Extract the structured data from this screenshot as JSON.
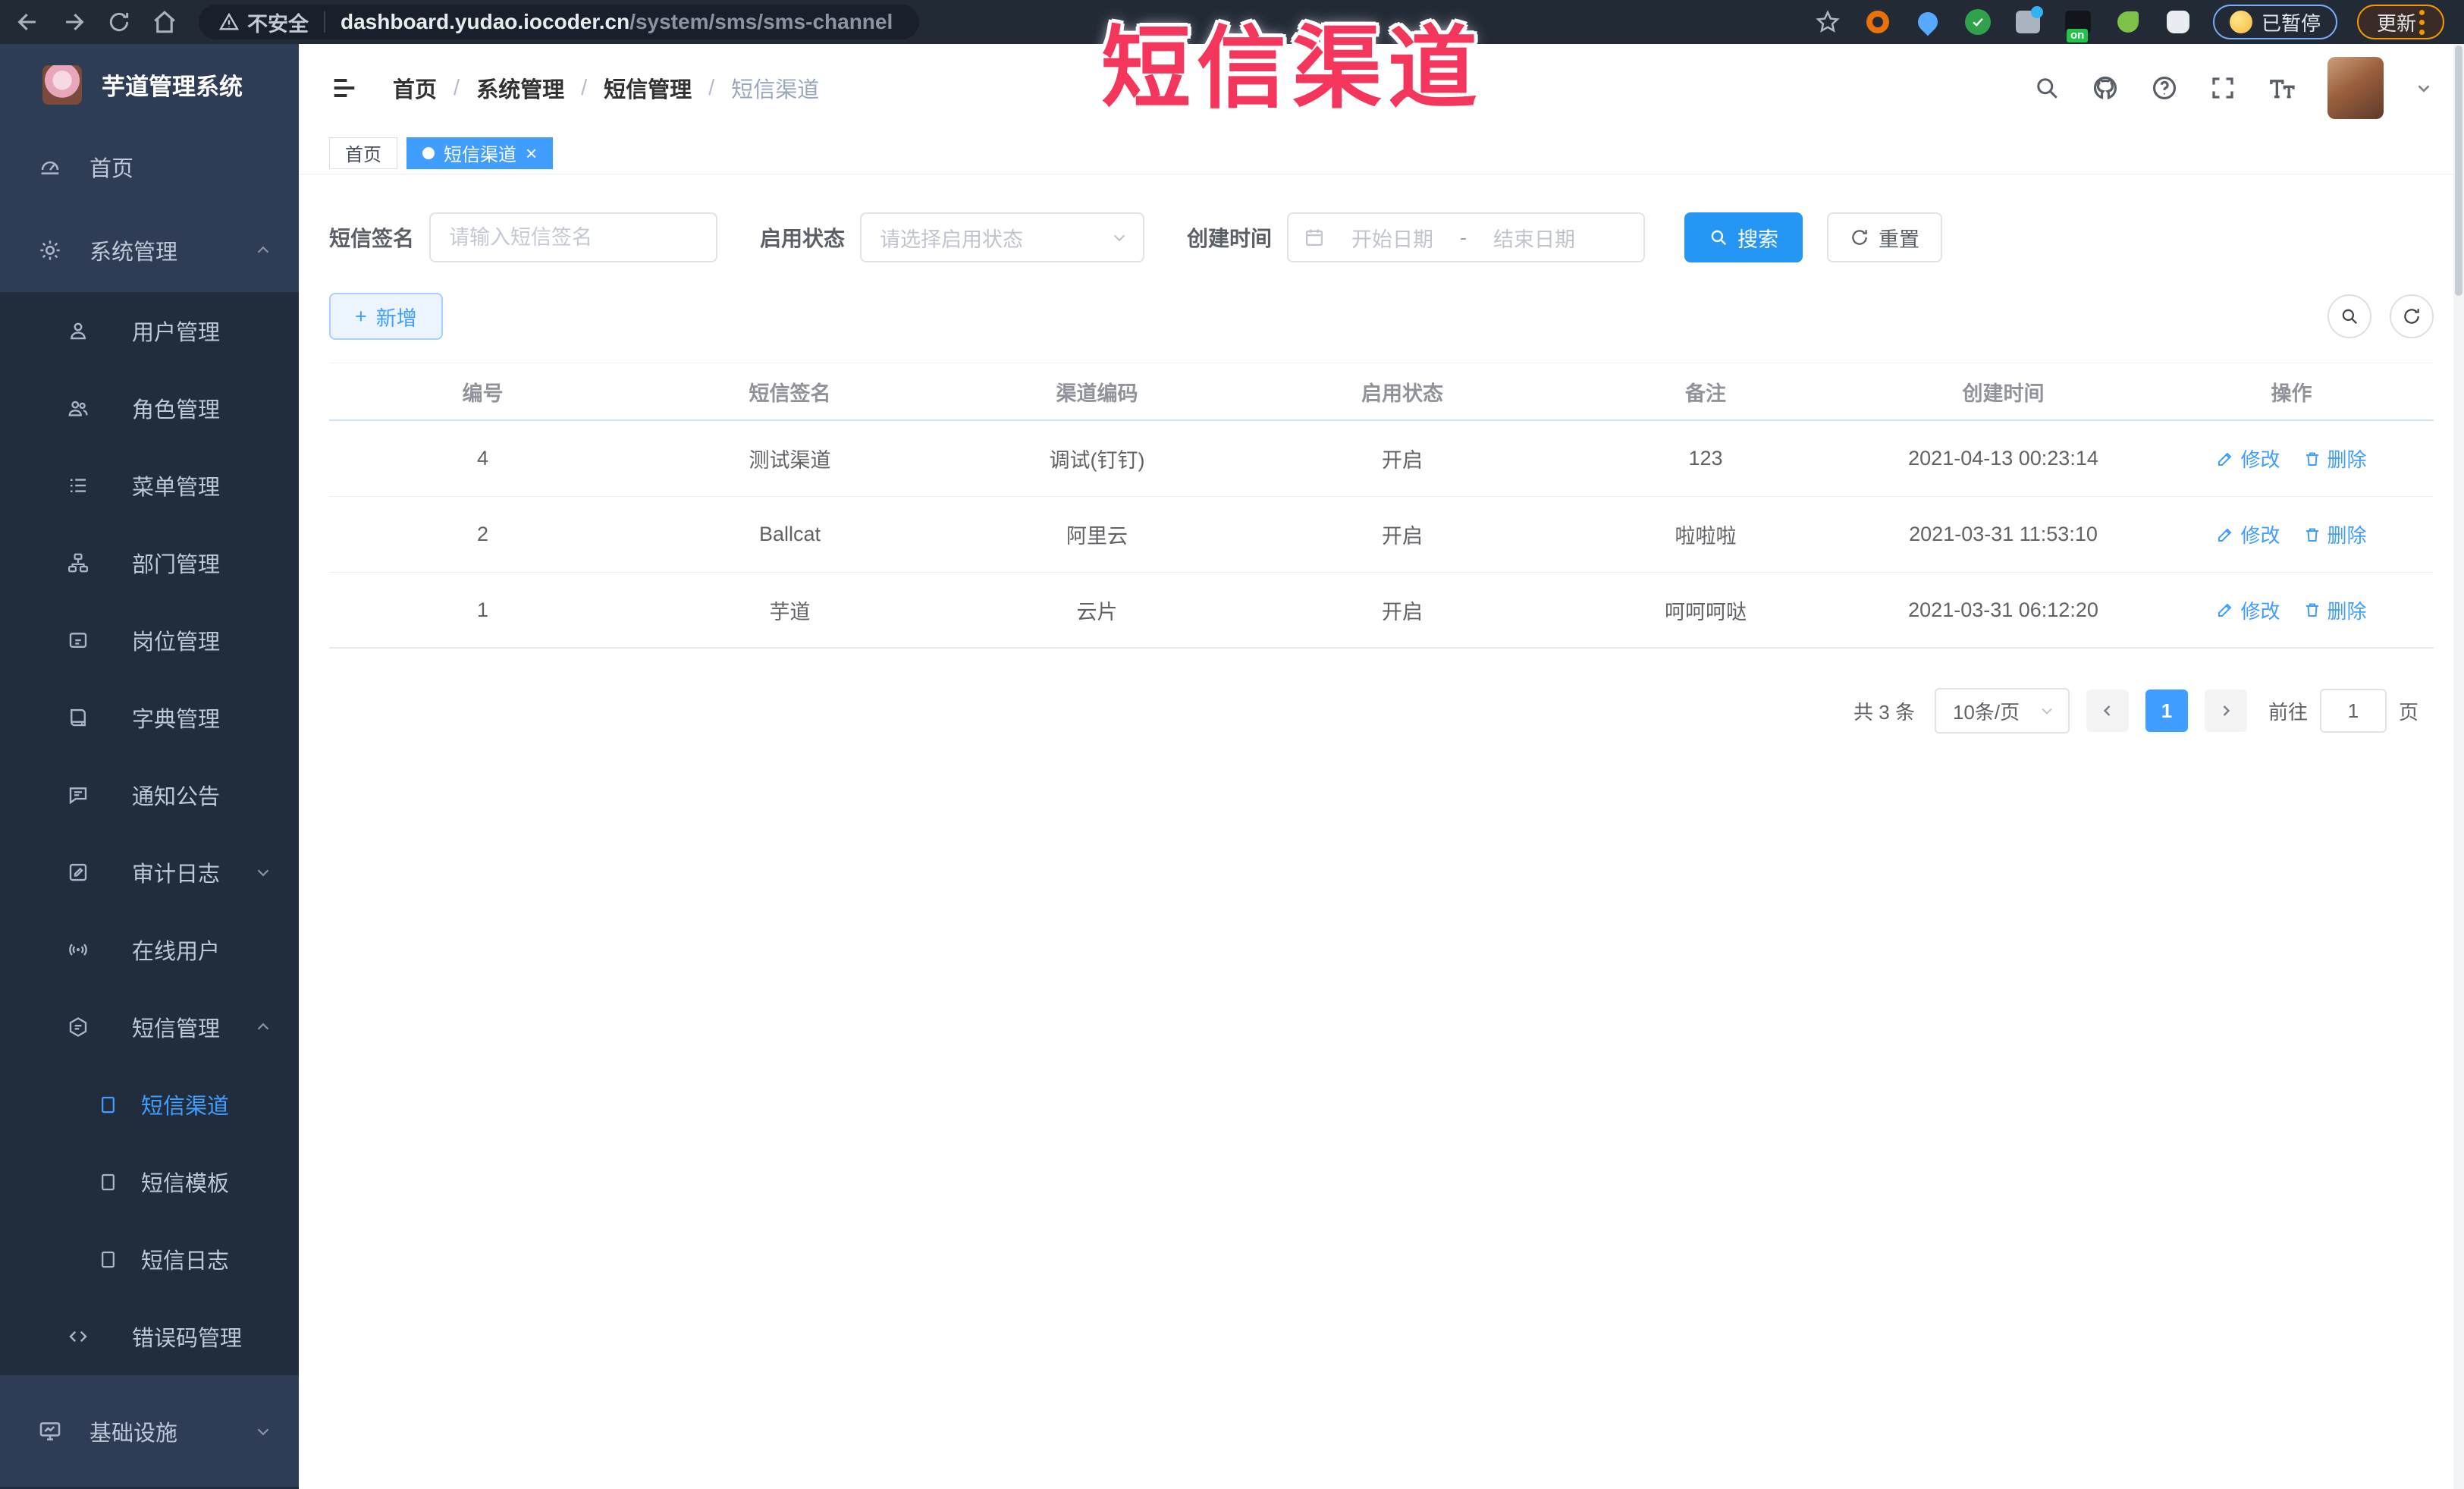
{
  "browser": {
    "security_label": "不安全",
    "url_host": "dashboard.yudao.iocoder.cn",
    "url_path": "/system/sms/sms-channel",
    "ext_badge": "on",
    "paused_label": "已暂停",
    "update_label": "更新"
  },
  "annotation": {
    "title": "短信渠道",
    "color": "#f5365c"
  },
  "app_title": "芋道管理系统",
  "sidebar": {
    "items": [
      {
        "label": "首页"
      },
      {
        "label": "系统管理"
      },
      {
        "label": "用户管理"
      },
      {
        "label": "角色管理"
      },
      {
        "label": "菜单管理"
      },
      {
        "label": "部门管理"
      },
      {
        "label": "岗位管理"
      },
      {
        "label": "字典管理"
      },
      {
        "label": "通知公告"
      },
      {
        "label": "审计日志"
      },
      {
        "label": "在线用户"
      },
      {
        "label": "短信管理"
      },
      {
        "label": "短信渠道"
      },
      {
        "label": "短信模板"
      },
      {
        "label": "短信日志"
      },
      {
        "label": "错误码管理"
      },
      {
        "label": "基础设施"
      }
    ]
  },
  "breadcrumb": {
    "separator": "/",
    "items": [
      "首页",
      "系统管理",
      "短信管理",
      "短信渠道"
    ]
  },
  "tabs": [
    {
      "label": "首页"
    },
    {
      "label": "短信渠道",
      "close": "×"
    }
  ],
  "filters": {
    "sign_label": "短信签名",
    "sign_placeholder": "请输入短信签名",
    "status_label": "启用状态",
    "status_placeholder": "请选择启用状态",
    "time_label": "创建时间",
    "start_placeholder": "开始日期",
    "range_separator": "-",
    "end_placeholder": "结束日期",
    "search_label": "搜索",
    "reset_label": "重置"
  },
  "toolbar": {
    "add_label": "新增",
    "plus": "+"
  },
  "table": {
    "headers": [
      "编号",
      "短信签名",
      "渠道编码",
      "启用状态",
      "备注",
      "创建时间",
      "操作"
    ],
    "edit_label": "修改",
    "delete_label": "删除",
    "rows": [
      {
        "id": "4",
        "sign": "测试渠道",
        "code": "调试(钉钉)",
        "status": "开启",
        "remark": "123",
        "created": "2021-04-13 00:23:14"
      },
      {
        "id": "2",
        "sign": "Ballcat",
        "code": "阿里云",
        "status": "开启",
        "remark": "啦啦啦",
        "created": "2021-03-31 11:53:10"
      },
      {
        "id": "1",
        "sign": "芋道",
        "code": "云片",
        "status": "开启",
        "remark": "呵呵呵哒",
        "created": "2021-03-31 06:12:20"
      }
    ]
  },
  "pagination": {
    "total": "共 3 条",
    "page_size": "10条/页",
    "current_page": "1",
    "goto_label": "前往",
    "goto_value": "1",
    "unit_label": "页"
  },
  "colors": {
    "accent": "#409eff",
    "annotation": "#f5365c"
  }
}
